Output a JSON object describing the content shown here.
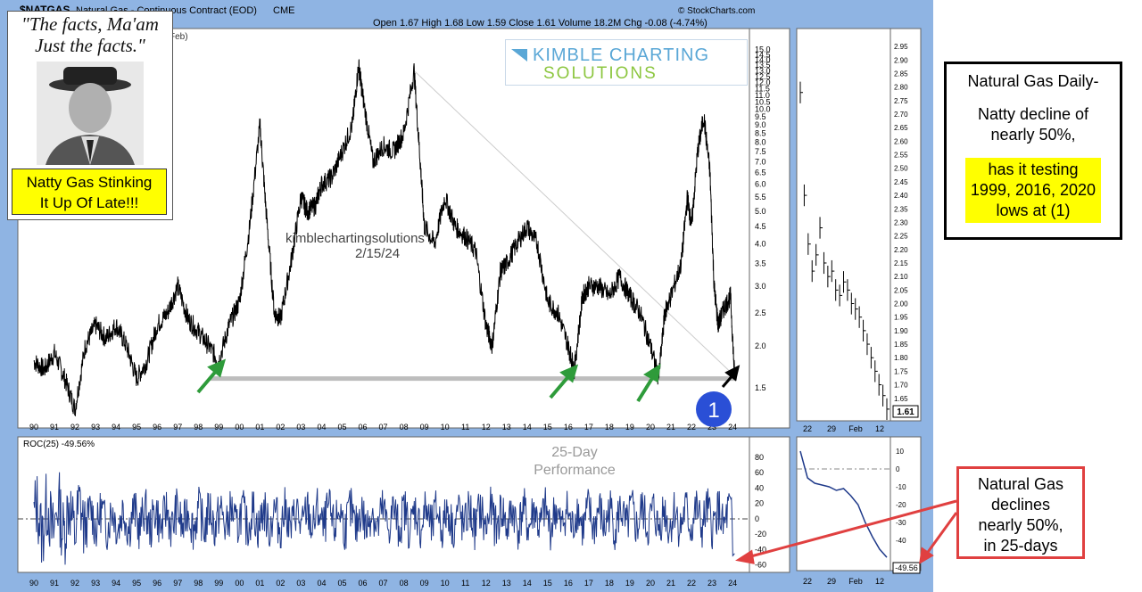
{
  "header": {
    "symbol": "$NATGAS",
    "description": "Natural Gas - Continuous Contract (EOD)",
    "exchange": "CME",
    "ohlc": "Open 1.67  High 1.68  Low 1.59  Close 1.61  Volume 18.2M  Chg -0.08 (-4.74%)",
    "credit": "© StockCharts.com",
    "legend_fragment": "Feb)"
  },
  "quote_panel": {
    "quote_line1": "\"The facts, Ma'am",
    "quote_line2": "Just the facts.\"",
    "caption_line1": "Natty Gas Stinking",
    "caption_line2": "It Up Of Late!!!"
  },
  "logo": {
    "line1": "KIMBLE CHARTING",
    "line2": "SOLUTIONS",
    "accent": "#5aa7d6",
    "accent2": "#8cc63f"
  },
  "watermark": {
    "site": "kimblechartingsolutions",
    "date": "2/15/24"
  },
  "marker": {
    "label": "1",
    "color": "#2a4fd6"
  },
  "note_box": {
    "line1": "Natural Gas Daily-",
    "line2": "Natty decline of",
    "line3": "nearly 50%,",
    "line4": "has it testing",
    "line5": "1999, 2016, 2020",
    "line6": "lows at (1)"
  },
  "callout": {
    "line1": "Natural Gas",
    "line2": "declines",
    "line3": "nearly 50%,",
    "line4": "in 25-days",
    "color": "#e04040"
  },
  "roc_panel": {
    "label": "ROC(25) -49.56%",
    "title_line1": "25-Day",
    "title_line2": "Performance",
    "value_tag": "-49.56"
  },
  "price_tag": "1.61",
  "colors": {
    "price": "#000000",
    "roc": "#1f3a8a",
    "support": "#bdbdbd",
    "arrow_green": "#2e9b3a",
    "panel": "#8fb4e3"
  },
  "chart_data": [
    {
      "type": "line",
      "title": "Natural Gas - Continuous Contract (EOD)",
      "y_scale": "log",
      "x_ticks": [
        "90",
        "91",
        "92",
        "93",
        "94",
        "95",
        "96",
        "97",
        "98",
        "99",
        "00",
        "01",
        "02",
        "03",
        "04",
        "05",
        "06",
        "07",
        "08",
        "09",
        "10",
        "11",
        "12",
        "13",
        "14",
        "15",
        "16",
        "17",
        "18",
        "19",
        "20",
        "21",
        "22",
        "23",
        "24"
      ],
      "y_ticks": [
        "1.5",
        "2.0",
        "2.5",
        "3.0",
        "3.5",
        "4.0",
        "4.5",
        "5.0",
        "5.5",
        "6.0",
        "6.5",
        "7.0",
        "7.5",
        "8.0",
        "8.5",
        "9.0",
        "9.5",
        "10.0",
        "10.5",
        "11.0",
        "11.5",
        "12.0",
        "12.5",
        "13.0",
        "13.5",
        "14.0",
        "14.5",
        "15.0"
      ],
      "x": [
        1990.0,
        1990.5,
        1991.0,
        1991.5,
        1992.0,
        1992.5,
        1993.0,
        1993.5,
        1994.0,
        1994.5,
        1995.0,
        1995.5,
        1996.0,
        1996.5,
        1997.0,
        1997.5,
        1998.0,
        1998.5,
        1999.0,
        1999.5,
        2000.0,
        2000.5,
        2001.0,
        2001.3,
        2001.7,
        2002.0,
        2002.5,
        2003.0,
        2003.3,
        2003.7,
        2004.0,
        2004.5,
        2005.0,
        2005.5,
        2005.8,
        2006.0,
        2006.5,
        2007.0,
        2007.5,
        2008.0,
        2008.5,
        2008.8,
        2009.0,
        2009.5,
        2010.0,
        2010.5,
        2011.0,
        2011.5,
        2012.0,
        2012.3,
        2012.7,
        2013.0,
        2013.5,
        2014.0,
        2014.5,
        2015.0,
        2015.5,
        2016.0,
        2016.3,
        2016.7,
        2017.0,
        2017.5,
        2018.0,
        2018.5,
        2019.0,
        2019.5,
        2020.0,
        2020.4,
        2020.7,
        2021.0,
        2021.5,
        2021.8,
        2022.0,
        2022.3,
        2022.6,
        2022.9,
        2023.1,
        2023.3,
        2023.6,
        2023.9,
        2024.1
      ],
      "y": [
        1.8,
        1.7,
        1.9,
        1.6,
        1.3,
        2.0,
        2.3,
        2.1,
        2.3,
        2.0,
        1.6,
        1.8,
        2.3,
        2.5,
        3.0,
        2.4,
        2.2,
        2.0,
        1.8,
        2.3,
        2.7,
        4.5,
        9.0,
        5.0,
        2.5,
        2.4,
        3.5,
        5.5,
        5.0,
        5.2,
        6.0,
        6.3,
        7.5,
        9.0,
        13.5,
        11.0,
        7.0,
        7.8,
        7.5,
        8.5,
        13.0,
        7.0,
        4.5,
        4.0,
        5.5,
        4.5,
        4.2,
        3.8,
        2.3,
        2.0,
        3.3,
        3.5,
        4.0,
        4.5,
        4.0,
        2.7,
        2.5,
        2.0,
        1.7,
        2.8,
        3.0,
        3.0,
        2.8,
        3.2,
        2.8,
        2.5,
        2.0,
        1.6,
        2.5,
        2.8,
        3.5,
        5.5,
        4.5,
        7.5,
        9.5,
        6.5,
        3.0,
        2.3,
        2.6,
        2.8,
        1.61
      ],
      "support_level": 1.6,
      "ylim": [
        1.2,
        16.5
      ]
    },
    {
      "type": "line",
      "title": "ROC(25) -49.56%",
      "y_ticks": [
        "80",
        "60",
        "40",
        "20",
        "0",
        "-20",
        "-40",
        "-60"
      ],
      "ylim": [
        -65,
        95
      ],
      "last_value": -49.56
    },
    {
      "type": "line",
      "title": "Recent price (inset)",
      "x_ticks": [
        "22",
        "29",
        "Feb",
        "12"
      ],
      "y_ticks": [
        "2.95",
        "2.90",
        "2.85",
        "2.80",
        "2.75",
        "2.70",
        "2.65",
        "2.60",
        "2.55",
        "2.50",
        "2.45",
        "2.40",
        "2.35",
        "2.30",
        "2.25",
        "2.20",
        "2.15",
        "2.10",
        "2.05",
        "2.00",
        "1.95",
        "1.90",
        "1.85",
        "1.80",
        "1.75",
        "1.70",
        "1.65"
      ],
      "ylim": [
        1.58,
        2.99
      ],
      "values": [
        2.78,
        2.4,
        2.22,
        2.12,
        2.18,
        2.28,
        2.15,
        2.1,
        2.12,
        2.05,
        2.03,
        2.08,
        2.05,
        2.0,
        1.98,
        1.95,
        1.9,
        1.85,
        1.8,
        1.75,
        1.7,
        1.66,
        1.61
      ]
    },
    {
      "type": "line",
      "title": "Recent ROC (inset)",
      "x_ticks": [
        "22",
        "29",
        "Feb",
        "12"
      ],
      "y_ticks": [
        "10",
        "0",
        "-10",
        "-20",
        "-30",
        "-40"
      ],
      "ylim": [
        -55,
        15
      ],
      "values": [
        10,
        -5,
        -8,
        -9,
        -10,
        -12,
        -11,
        -15,
        -20,
        -30,
        -38,
        -45,
        -49.56
      ]
    }
  ]
}
